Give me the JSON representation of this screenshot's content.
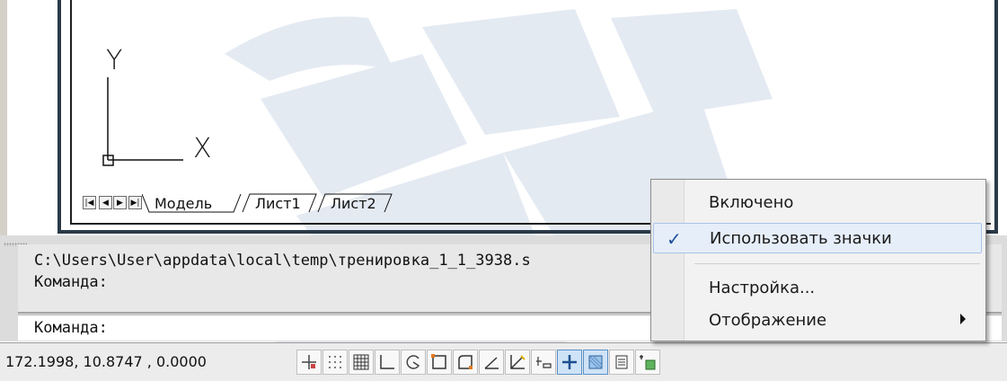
{
  "viewport": {
    "ucs_icon": {
      "y_label": "Y",
      "x_label": "X"
    }
  },
  "layout_tabs": {
    "nav": [
      "first",
      "prev",
      "next",
      "last"
    ],
    "tabs": [
      "Модель",
      "Лист1",
      "Лист2"
    ],
    "active": "Модель"
  },
  "command_window": {
    "history": [
      "C:\\Users\\User\\appdata\\local\\temp\\тренировка_1_1_3938.s",
      "Команда:"
    ],
    "prompt": "Команда:"
  },
  "status_bar": {
    "coordinates": "172.1998, 10.8747 , 0.0000",
    "toggles": [
      {
        "icon": "infer-constraints-icon",
        "on": false
      },
      {
        "icon": "snap-icon",
        "on": false
      },
      {
        "icon": "grid-icon",
        "on": false
      },
      {
        "icon": "ortho-icon",
        "on": false
      },
      {
        "icon": "polar-icon",
        "on": false
      },
      {
        "icon": "object-snap-icon",
        "on": false
      },
      {
        "icon": "3d-object-snap-icon",
        "on": false
      },
      {
        "icon": "object-snap-tracking-icon",
        "on": false
      },
      {
        "icon": "dynamic-ucs-icon",
        "on": false
      },
      {
        "icon": "dynamic-input-icon",
        "on": false
      },
      {
        "icon": "lineweight-icon",
        "on": true
      },
      {
        "icon": "transparency-icon",
        "on": true
      },
      {
        "icon": "quick-properties-icon",
        "on": false
      },
      {
        "icon": "selection-cycling-icon",
        "on": false
      }
    ]
  },
  "context_menu": {
    "items": [
      {
        "label": "Включено",
        "checked": false
      },
      {
        "label": "Использовать значки",
        "checked": true,
        "highlighted": true
      },
      {
        "label": "Настройка...",
        "checked": false
      },
      {
        "label": "Отображение",
        "checked": false,
        "submenu": true
      }
    ],
    "check_glyph": "✓"
  },
  "colors": {
    "frame": "#2b3a48",
    "menu_highlight": "#e6eef9",
    "menu_highlight_border": "#a9c4e9",
    "check": "#1f4f9a",
    "watermark": "#dbe4ee"
  }
}
